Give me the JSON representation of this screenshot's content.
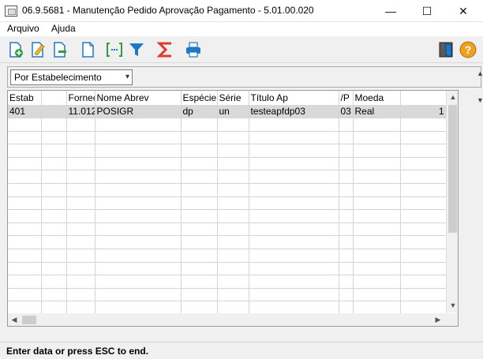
{
  "window": {
    "title": "06.9.5681 - Manutenção Pedido Aprovação Pagamento - 5.01.00.020",
    "minimize": "—",
    "maximize": "☐",
    "close": "✕"
  },
  "menu": {
    "arquivo": "Arquivo",
    "ajuda": "Ajuda"
  },
  "toolbar": {
    "icons": [
      "add-icon",
      "edit-icon",
      "remove-icon",
      "blank-page-icon",
      "select-icon",
      "filter-icon",
      "sum-icon",
      "print-icon",
      "exit-icon",
      "help-icon"
    ],
    "help_glyph": "?"
  },
  "filter": {
    "selected": "Por Estabelecimento"
  },
  "grid": {
    "headers": [
      "Estab",
      "",
      "Fornec",
      "Nome Abrev",
      "Espécie",
      "Série",
      "Título Ap",
      "/P",
      "Moeda",
      ""
    ],
    "row1": {
      "estab": "401",
      "blank": "",
      "fornec": "11.012",
      "nome": "POSIGR",
      "especie": "dp",
      "serie": "un",
      "titulo": "testeapfdp03",
      "parcela": "03",
      "moeda": "Real",
      "extra": "1"
    }
  },
  "status": {
    "text": "Enter data or press ESC to end."
  },
  "colors": {
    "accent_blue": "#1e78c8",
    "sum_red": "#e03a2e",
    "select_green": "#2e9e3e",
    "help_orange": "#f0a020"
  }
}
